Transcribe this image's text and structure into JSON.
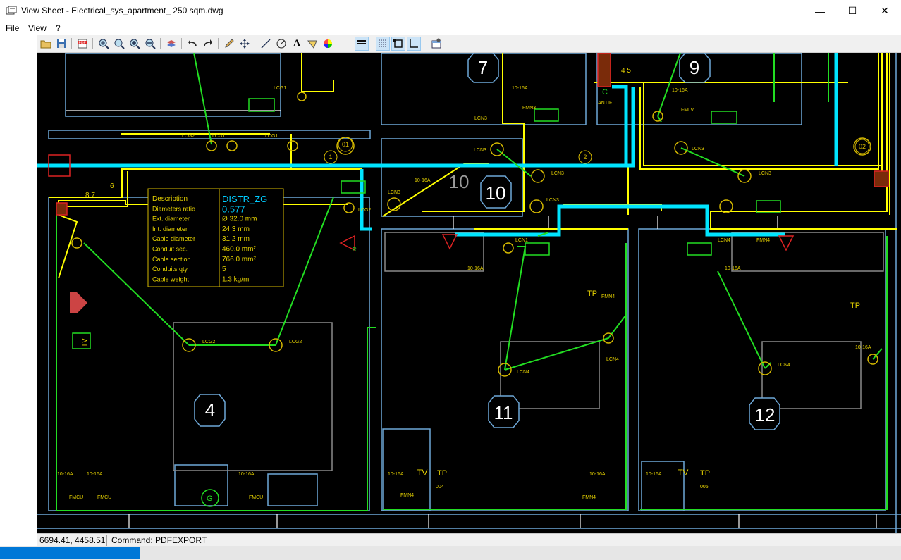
{
  "window": {
    "title": "View Sheet - Electrical_sys_apartment_ 250 sqm.dwg",
    "minimize_glyph": "—",
    "maximize_glyph": "☐",
    "close_glyph": "✕"
  },
  "menu": {
    "items": [
      {
        "label": "File"
      },
      {
        "label": "View"
      },
      {
        "label": "?"
      }
    ]
  },
  "toolbar": {
    "buttons": [
      "open-icon",
      "save-icon",
      "pdf-export-icon",
      "zoom-window-icon",
      "zoom-realtime-icon",
      "zoom-in-icon",
      "zoom-out-icon",
      "layers-icon",
      "undo-icon",
      "redo-icon",
      "pencil-icon",
      "pan-icon",
      "line-icon",
      "measure-angle-icon",
      "text-icon",
      "hatch-icon",
      "color-wheel-icon",
      "lineweight-icon",
      "grid-icon",
      "snap-icon",
      "ortho-icon",
      "properties-icon"
    ]
  },
  "drawing": {
    "room_numbers": {
      "r4": "4",
      "r7": "7",
      "r9": "9",
      "r10": "10",
      "r11": "11",
      "r12": "12"
    },
    "bubbles": {
      "b01": "01",
      "b02": "02",
      "b1": "1",
      "b2": "2"
    },
    "table": {
      "rows": [
        {
          "label": "Description",
          "value": "DISTR_ZG"
        },
        {
          "label": "Diameters ratio",
          "value": "0.577"
        },
        {
          "label": "Ext. diameter",
          "value": "Ø 32.0 mm"
        },
        {
          "label": "Int. diameter",
          "value": "24.3 mm"
        },
        {
          "label": "Cable diameter",
          "value": "31.2 mm"
        },
        {
          "label": "Conduit sec.",
          "value": "460.0 mm²"
        },
        {
          "label": "Cable section",
          "value": "766.0 mm²"
        },
        {
          "label": "Conduits qty",
          "value": "5"
        },
        {
          "label": "Cable weight",
          "value": "1.3 kg/m"
        }
      ]
    },
    "labels": {
      "lcg1a": "LCG1",
      "lcg1b": "LCG1",
      "lcg1c": "LCG1",
      "lcg2a": "LCG2",
      "lcg2b": "LCG2",
      "lcg2c": "LCG2",
      "lcg2d": "LCG2",
      "lcn1": "LCN1",
      "lcn3a": "LCN3",
      "lcn3b": "LCN3",
      "lcn3c": "LCN3",
      "lcn3d": "LCN3",
      "lcn3e": "LCN3",
      "lcn3f": "LCN3",
      "lcn3g": "LCN3",
      "lcn4a": "LCN4",
      "lcn4b": "LCN4",
      "lcn4c": "LCN4",
      "lcn4d": "LCN4",
      "s16a_1": "10-16A",
      "s16a_2": "10-16A",
      "s16a_3": "10-16A",
      "s16a_4": "10-16A",
      "s16a_5": "10-16A",
      "s16a_6": "10-16A",
      "s16a_7": "10-16A",
      "s16a_8": "10-16A",
      "s16a_9": "10-16A",
      "s16a_10": "10-16A",
      "s16a_11": "10-16A",
      "s16a_12": "10-16A",
      "fmcu1": "FMCU",
      "fmcu2": "FMCU",
      "fmcu3": "FMCU",
      "fmn4a": "FMN4",
      "fmn4b": "FMN4",
      "fmn4c": "FMN4",
      "fmn4d": "FMN4",
      "fmn3": "FMN3",
      "fmlv": "FMLV",
      "tv1": "TV",
      "tv2": "TV",
      "tv3": "TV",
      "tp1": "TP",
      "tp2": "TP",
      "tp3": "TP",
      "tp4": "TP",
      "c004": "004",
      "c005": "005",
      "antif": "ANTIF",
      "c": "C",
      "n45": "4 5",
      "n87": "8 7",
      "n6": "6",
      "g": "G",
      "r": "R"
    }
  },
  "status": {
    "coords": "6694.41, 4458.51",
    "command": "Command: PDFEXPORT"
  },
  "progress": {
    "fraction": 0.155
  },
  "colors": {
    "canvas_bg": "#000000",
    "wall": "#6ea8d8",
    "cable": "#ffff00",
    "circuit": "#22dd22",
    "trunk": "#00e5ff",
    "room_number": "#ffffff",
    "table_value": "#00ccff",
    "progress": "#0078d7"
  }
}
